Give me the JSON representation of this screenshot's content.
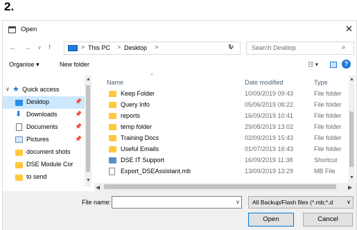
{
  "step_label": "2.",
  "dialog": {
    "title": "Open",
    "close_icon": "close-icon"
  },
  "address": {
    "crumbs": [
      "This PC",
      "Desktop"
    ],
    "separator": ">",
    "dropdown": "∨"
  },
  "search": {
    "placeholder": "Search Desktop"
  },
  "toolbar": {
    "organise": "Organise ▾",
    "new_folder": "New folder"
  },
  "sidebar": {
    "items": [
      {
        "label": "Quick access",
        "icon": "star-icon",
        "pinned": false,
        "selected": false
      },
      {
        "label": "Desktop",
        "icon": "desktop-icon",
        "pinned": true,
        "selected": true
      },
      {
        "label": "Downloads",
        "icon": "download-icon",
        "pinned": true,
        "selected": false
      },
      {
        "label": "Documents",
        "icon": "documents-icon",
        "pinned": true,
        "selected": false
      },
      {
        "label": "Pictures",
        "icon": "pictures-icon",
        "pinned": true,
        "selected": false
      },
      {
        "label": "document shots",
        "icon": "folder-icon",
        "pinned": false,
        "selected": false
      },
      {
        "label": "DSE Module Cor",
        "icon": "folder-icon",
        "pinned": false,
        "selected": false
      },
      {
        "label": "to send",
        "icon": "folder-icon",
        "pinned": false,
        "selected": false
      }
    ]
  },
  "columns": {
    "name": "Name",
    "date": "Date modified",
    "type": "Type"
  },
  "files": [
    {
      "name": "Keep Folder",
      "date": "10/09/2019 09:43",
      "type": "File folder",
      "icon": "folder-icon"
    },
    {
      "name": "Query Info",
      "date": "05/06/2019 08:22",
      "type": "File folder",
      "icon": "folder-icon"
    },
    {
      "name": "reports",
      "date": "16/09/2019 10:41",
      "type": "File folder",
      "icon": "folder-icon"
    },
    {
      "name": "temp folder",
      "date": "29/08/2019 13:02",
      "type": "File folder",
      "icon": "folder-icon"
    },
    {
      "name": "Training Docs",
      "date": "02/09/2019 15:43",
      "type": "File folder",
      "icon": "folder-icon"
    },
    {
      "name": "Useful Emails",
      "date": "01/07/2019 16:43",
      "type": "File folder",
      "icon": "folder-icon"
    },
    {
      "name": "DSE IT Support",
      "date": "16/09/2019 11:38",
      "type": "Shortcut",
      "icon": "shortcut-icon"
    },
    {
      "name": "Export_DSEAssistant.mb",
      "date": "13/09/2019 13:29",
      "type": "MB File",
      "icon": "file-icon"
    }
  ],
  "footer": {
    "file_name_label": "File name:",
    "file_name_value": "",
    "filter_value": "All Backup/Flash files (*.mb;*.d",
    "open_label": "Open",
    "cancel_label": "Cancel"
  }
}
